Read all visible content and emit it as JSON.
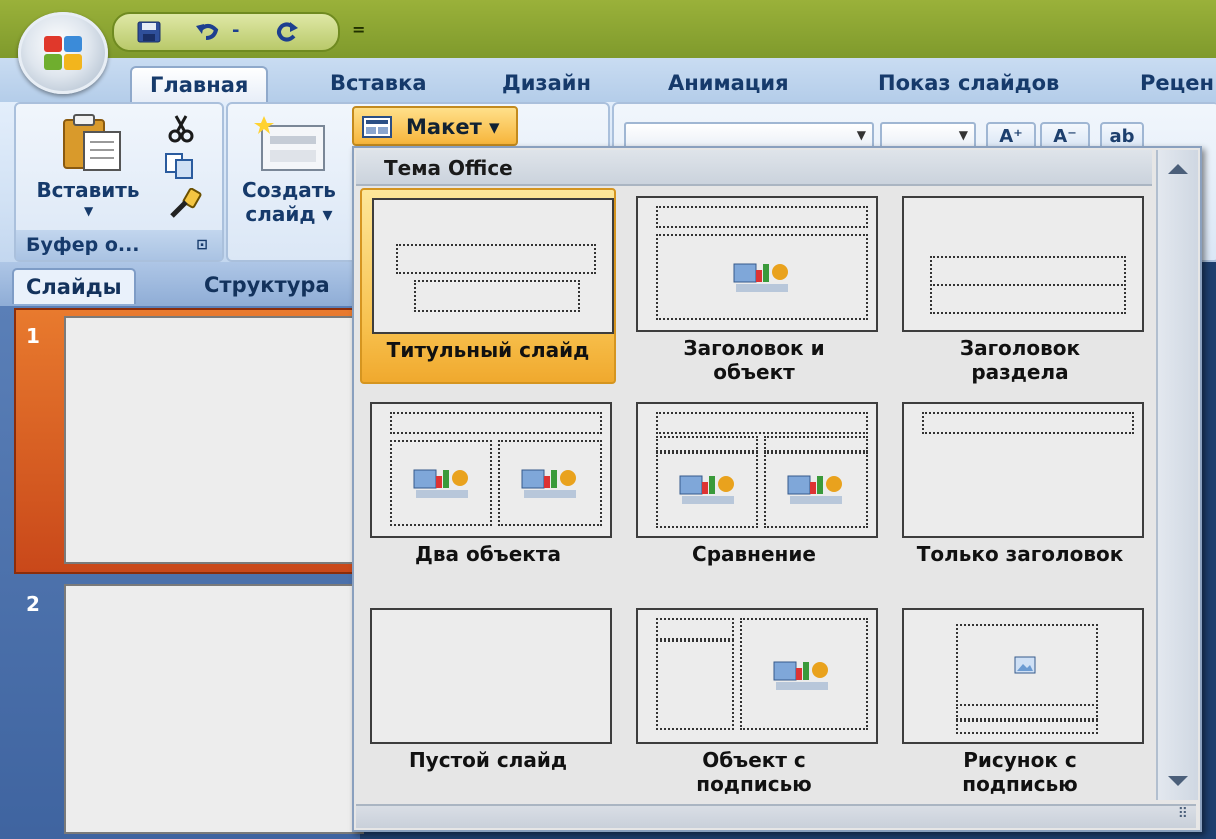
{
  "quick_access": {
    "separator": "="
  },
  "tabs": [
    {
      "label": "Главная"
    },
    {
      "label": "Вставка"
    },
    {
      "label": "Дизайн"
    },
    {
      "label": "Анимация"
    },
    {
      "label": "Показ слайдов"
    },
    {
      "label": "Рецен"
    }
  ],
  "ribbon": {
    "paste_label": "Вставить",
    "clipboard_group": "Буфер о...",
    "new_slide_line1": "Создать",
    "new_slide_line2": "слайд ▾",
    "layout_button": "Макет ▾",
    "font_grow": "A⁺",
    "font_shrink": "A⁻"
  },
  "slides_pane": {
    "tab_slides": "Слайды",
    "tab_outline": "Структура",
    "slide_numbers": [
      "1",
      "2"
    ]
  },
  "gallery": {
    "header": "Тема Office",
    "layouts": [
      {
        "label_1": "Титульный слайд",
        "label_2": ""
      },
      {
        "label_1": "Заголовок и",
        "label_2": "объект"
      },
      {
        "label_1": "Заголовок",
        "label_2": "раздела"
      },
      {
        "label_1": "Два объекта",
        "label_2": ""
      },
      {
        "label_1": "Сравнение",
        "label_2": ""
      },
      {
        "label_1": "Только заголовок",
        "label_2": ""
      },
      {
        "label_1": "Пустой слайд",
        "label_2": ""
      },
      {
        "label_1": "Объект с",
        "label_2": "подписью"
      },
      {
        "label_1": "Рисунок с",
        "label_2": "подписью"
      }
    ],
    "selected_layout": "Титульный слайд"
  },
  "colors": {
    "accent_selected": "#f8c24f",
    "titlebar": "#9ab13a",
    "ribbon_text": "#163a6b"
  }
}
